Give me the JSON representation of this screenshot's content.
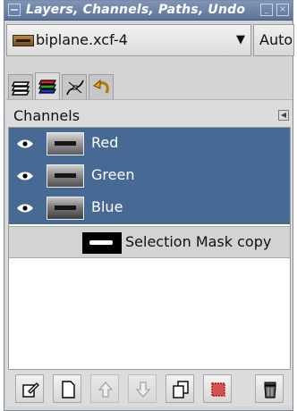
{
  "window": {
    "title": "Layers, Channels, Paths, Undo"
  },
  "image_selector": {
    "name": "biplane.xcf-4",
    "auto_label": "Auto"
  },
  "tabs": [
    {
      "name": "layers",
      "icon": "layers-icon",
      "active": false
    },
    {
      "name": "channels",
      "icon": "channels-icon",
      "active": true
    },
    {
      "name": "paths",
      "icon": "paths-icon",
      "active": false
    },
    {
      "name": "undo",
      "icon": "undo-icon",
      "active": false
    }
  ],
  "channels": {
    "header": "Channels",
    "items": [
      {
        "label": "Red",
        "visible": true,
        "selected": true
      },
      {
        "label": "Green",
        "visible": true,
        "selected": true
      },
      {
        "label": "Blue",
        "visible": true,
        "selected": true
      }
    ],
    "masks": [
      {
        "label": "Selection Mask copy"
      }
    ]
  },
  "toolbar": {
    "buttons": [
      {
        "name": "edit-channel-attributes",
        "icon": "edit-icon",
        "enabled": true
      },
      {
        "name": "new-channel",
        "icon": "new-document-icon",
        "enabled": true
      },
      {
        "name": "raise-channel",
        "icon": "arrow-up-icon",
        "enabled": false
      },
      {
        "name": "lower-channel",
        "icon": "arrow-down-icon",
        "enabled": false
      },
      {
        "name": "duplicate-channel",
        "icon": "duplicate-icon",
        "enabled": true
      },
      {
        "name": "channel-to-selection",
        "icon": "selection-icon",
        "enabled": true
      },
      {
        "name": "delete-channel",
        "icon": "trash-icon",
        "enabled": true
      }
    ]
  },
  "colors": {
    "selection": "#476a94",
    "titlebar": "#6d84a9"
  }
}
